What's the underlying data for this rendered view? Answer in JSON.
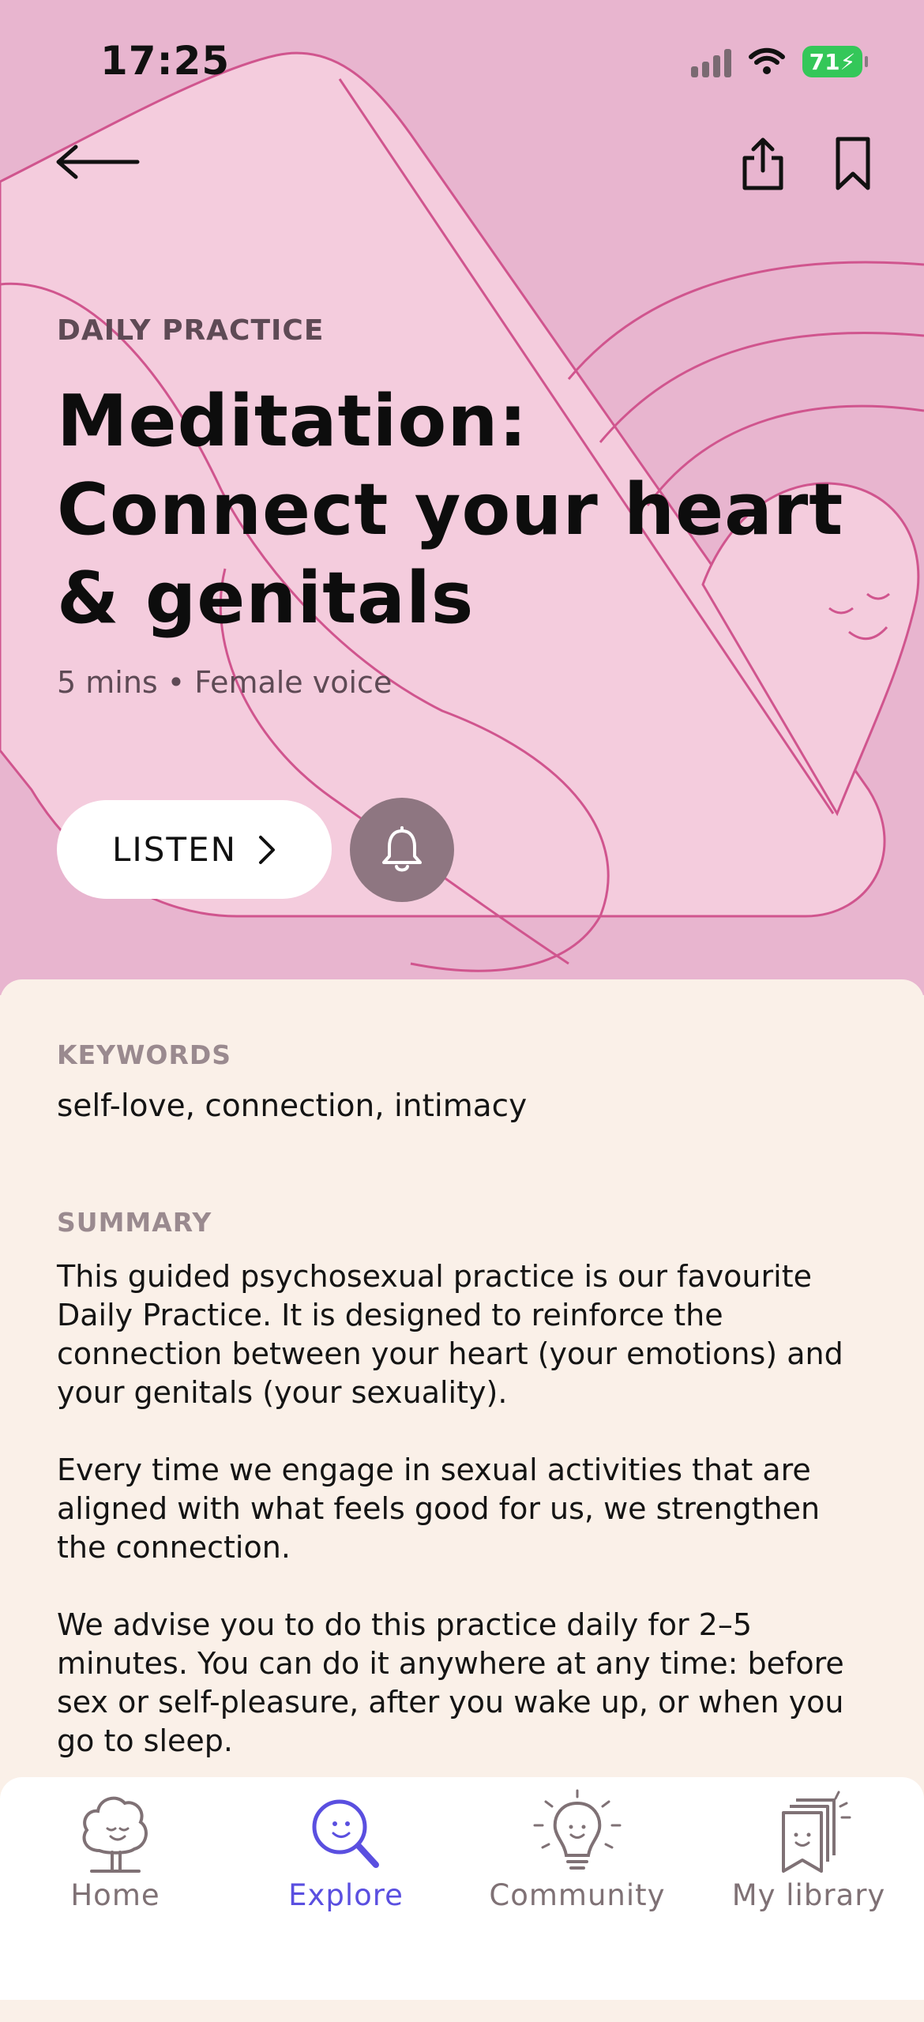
{
  "status_bar": {
    "time": "17:25",
    "battery": "71"
  },
  "header": {
    "eyebrow": "DAILY PRACTICE",
    "title": "Meditation: Connect your heart & genitals",
    "meta": "5 mins • Female voice",
    "listen_label": "LISTEN"
  },
  "details": {
    "keywords_label": "KEYWORDS",
    "keywords": "self-love, connection, intimacy",
    "summary_label": "SUMMARY",
    "summary_paragraphs": [
      "This guided psychosexual practice is our favourite Daily Practice. It is designed to reinforce the connection between your heart (your emotions) and your genitals (your sexuality).",
      "Every time we engage in sexual activities that are aligned with what feels good for us, we strengthen the connection.",
      "We advise you to do this practice daily for 2–5 minutes. You can do it anywhere at any time: before sex or self-pleasure, after you wake up, or when you go to sleep."
    ]
  },
  "tabs": [
    {
      "label": "Home",
      "icon": "tree-icon",
      "active": false
    },
    {
      "label": "Explore",
      "icon": "magnifier-icon",
      "active": true
    },
    {
      "label": "Community",
      "icon": "lightbulb-icon",
      "active": false
    },
    {
      "label": "My library",
      "icon": "books-icon",
      "active": false
    }
  ],
  "colors": {
    "hero_bg": "#E8B5CF",
    "hero_shape": "#F4CCDD",
    "line": "#D0558E",
    "content_bg": "#FAF0E8",
    "accent": "#5A4FE0",
    "bell_bg": "#8E7681",
    "battery": "#34C759"
  }
}
